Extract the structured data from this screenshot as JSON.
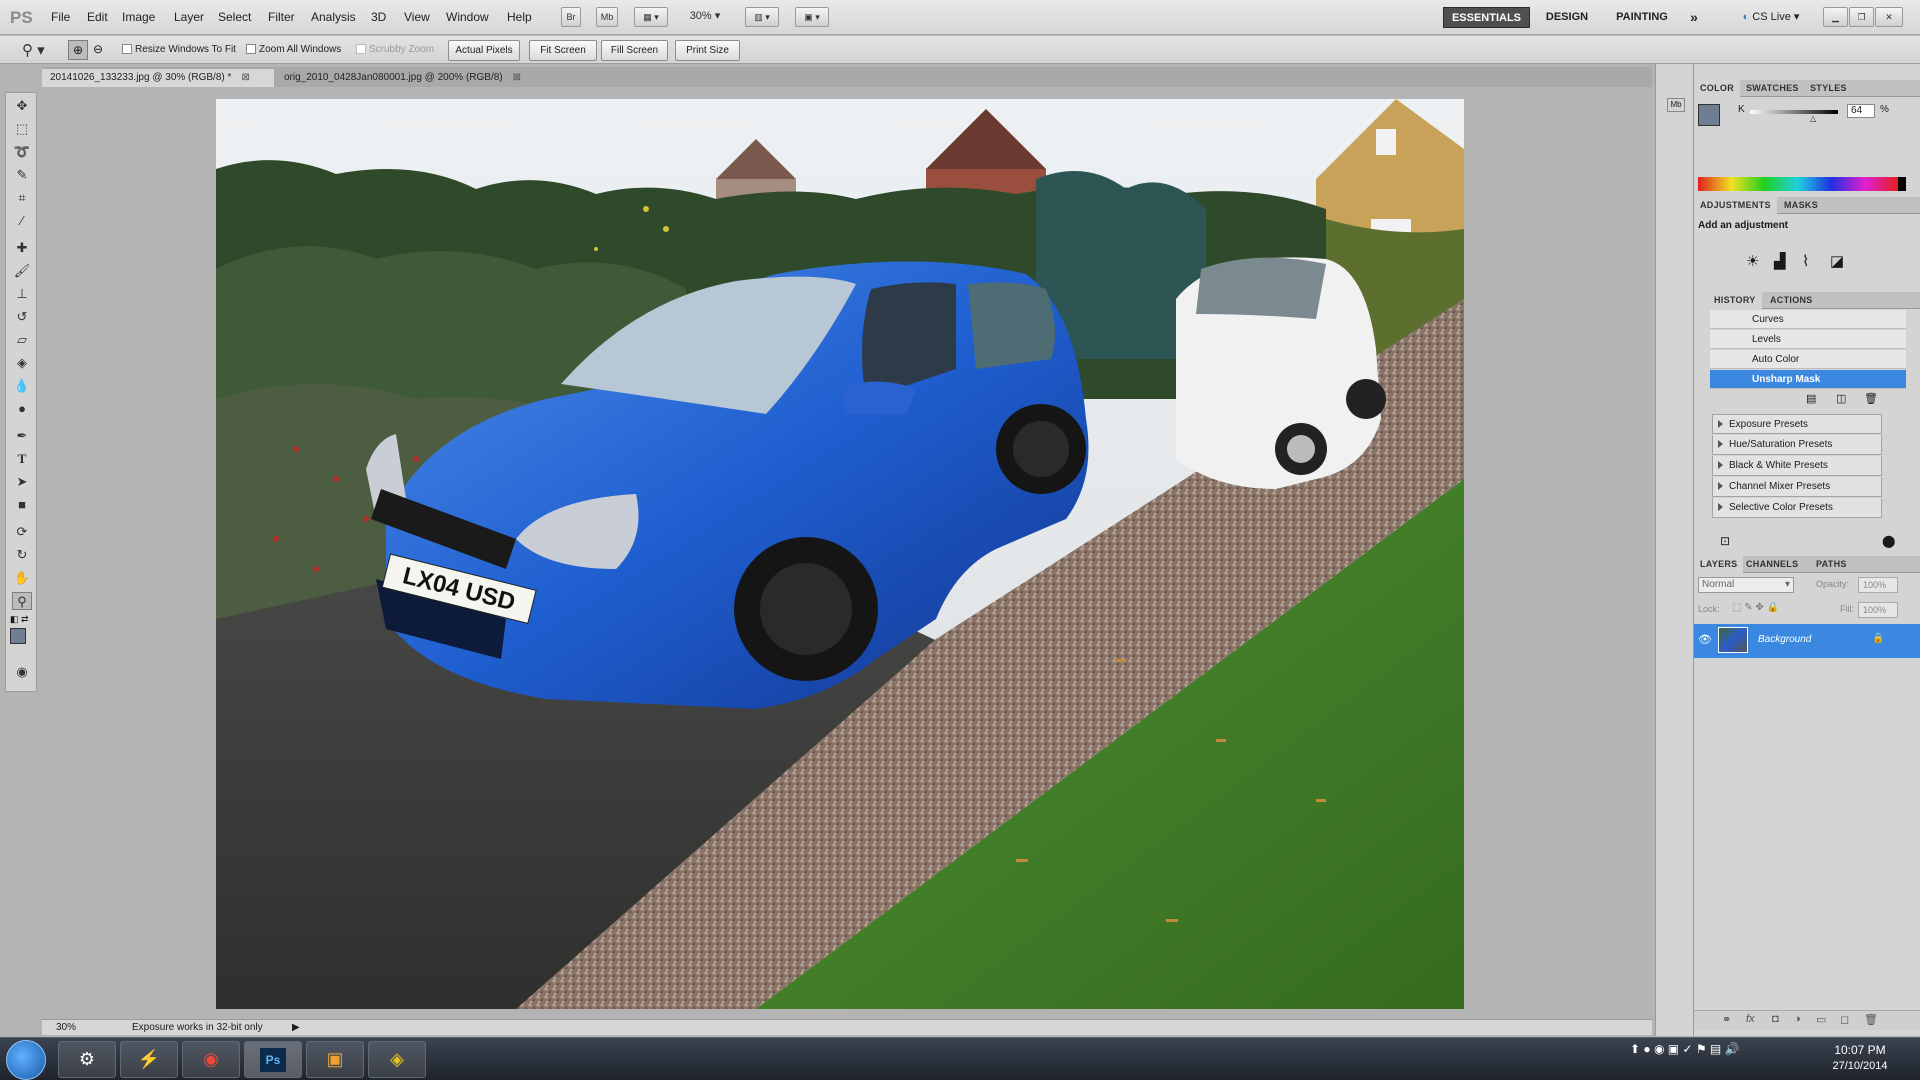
{
  "app": {
    "logo": "PS",
    "menu": [
      "File",
      "Edit",
      "Image",
      "Layer",
      "Select",
      "Filter",
      "Analysis",
      "3D",
      "View",
      "Window",
      "Help"
    ],
    "bridge_btn": "Br",
    "minibridge_btn": "Mb",
    "zoom_select": "30%",
    "workspaces": [
      "ESSENTIALS",
      "DESIGN",
      "PAINTING"
    ],
    "more_workspaces": "»",
    "cslive": "CS Live"
  },
  "options_bar": {
    "resize_windows": "Resize Windows To Fit",
    "zoom_all_windows": "Zoom All Windows",
    "scrubby_zoom": "Scrubby Zoom",
    "actual_pixels": "Actual Pixels",
    "fit_screen": "Fit Screen",
    "fill_screen": "Fill Screen",
    "print_size": "Print Size"
  },
  "documents": [
    {
      "label": "20141026_133233.jpg @ 30% (RGB/8) *"
    },
    {
      "label": "orig_2010_0428Jan080001.jpg @ 200% (RGB/8)"
    }
  ],
  "status_bar": {
    "zoom": "30%",
    "message": "Exposure works in 32-bit only"
  },
  "panels": {
    "color": {
      "tabs": [
        "COLOR",
        "SWATCHES",
        "STYLES"
      ],
      "channel": "K",
      "value": "64",
      "unit": "%",
      "slider_fraction": 0.64
    },
    "adjustments": {
      "tabs": [
        "ADJUSTMENTS",
        "MASKS"
      ],
      "heading": "Add an adjustment"
    },
    "history": {
      "tabs": [
        "HISTORY",
        "ACTIONS"
      ],
      "items": [
        "Curves",
        "Levels",
        "Auto Color",
        "Unsharp Mask"
      ],
      "selected": "Unsharp Mask"
    },
    "presets": [
      "Exposure Presets",
      "Hue/Saturation Presets",
      "Black & White Presets",
      "Channel Mixer Presets",
      "Selective Color Presets"
    ],
    "layers": {
      "tabs": [
        "LAYERS",
        "CHANNELS",
        "PATHS"
      ],
      "blend_mode": "Normal",
      "opacity_label": "Opacity:",
      "opacity": "100%",
      "lock_label": "Lock:",
      "fill_label": "Fill:",
      "fill": "100%",
      "layer_name": "Background"
    }
  },
  "photo": {
    "plate": "LX04 USD"
  },
  "taskbar": {
    "time": "10:07 PM",
    "date": "27/10/2014"
  }
}
